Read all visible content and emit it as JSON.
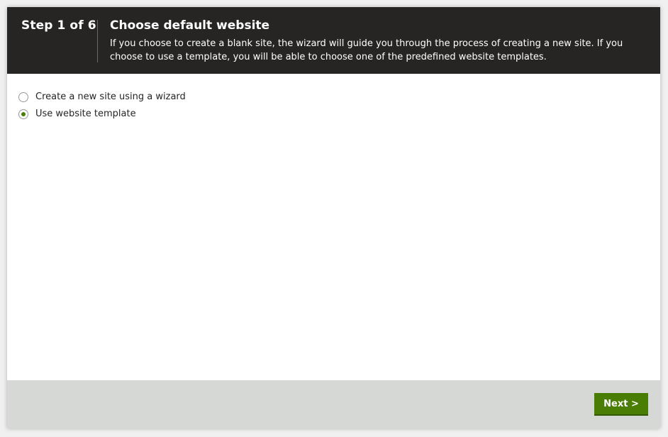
{
  "header": {
    "step_label": "Step 1 of 6",
    "title": "Choose default website",
    "description": "If you choose to create a blank site, the wizard will guide you through the process of creating a new site. If you choose to use a template, you will be able to choose one of the predefined website templates."
  },
  "options": [
    {
      "label": "Create a new site using a wizard",
      "checked": false
    },
    {
      "label": "Use website template",
      "checked": true
    }
  ],
  "footer": {
    "next_label": "Next >"
  },
  "colors": {
    "header_bg": "#262524",
    "accent": "#497d04",
    "footer_bg": "#d6d8d6"
  }
}
